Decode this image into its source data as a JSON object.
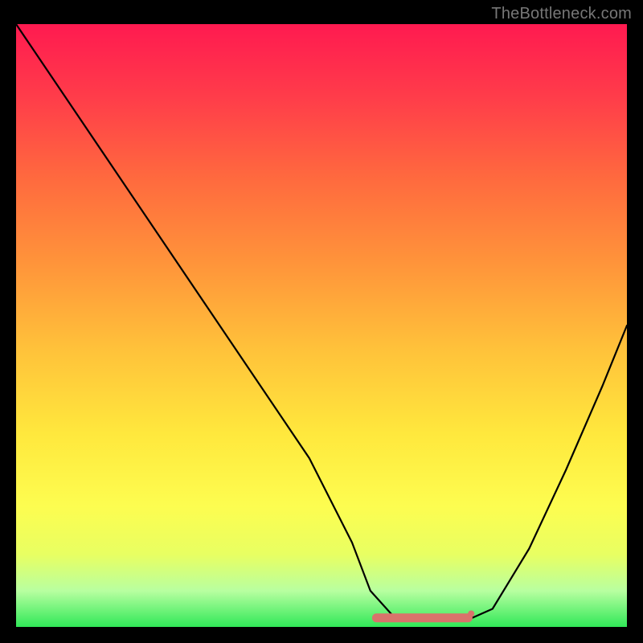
{
  "watermark": "TheBottleneck.com",
  "chart_data": {
    "type": "line",
    "title": "",
    "xlabel": "",
    "ylabel": "",
    "xlim": [
      0,
      100
    ],
    "ylim": [
      0,
      100
    ],
    "series": [
      {
        "name": "bottleneck-curve",
        "x": [
          0,
          8,
          16,
          24,
          32,
          40,
          48,
          55,
          58,
          62,
          66,
          70,
          74,
          78,
          84,
          90,
          96,
          100
        ],
        "values": [
          100,
          88,
          76,
          64,
          52,
          40,
          28,
          14,
          6,
          1.5,
          1.0,
          1.0,
          1.2,
          3,
          13,
          26,
          40,
          50
        ]
      }
    ],
    "annotations": [
      {
        "name": "valley-marker",
        "type": "thick-segment",
        "color": "#d9736b",
        "x": [
          59,
          74
        ],
        "y": [
          1.5,
          1.5
        ]
      },
      {
        "name": "valley-dot-right",
        "type": "dot",
        "color": "#d9736b",
        "x": 74.5,
        "y": 2.2,
        "r": 4
      }
    ],
    "gradient_stops": [
      {
        "pos": 0.0,
        "color": "#ff1a50"
      },
      {
        "pos": 0.12,
        "color": "#ff3c4a"
      },
      {
        "pos": 0.26,
        "color": "#ff6b3e"
      },
      {
        "pos": 0.4,
        "color": "#ff953a"
      },
      {
        "pos": 0.54,
        "color": "#ffc23a"
      },
      {
        "pos": 0.68,
        "color": "#ffe83d"
      },
      {
        "pos": 0.8,
        "color": "#fdfd50"
      },
      {
        "pos": 0.88,
        "color": "#e8ff62"
      },
      {
        "pos": 0.94,
        "color": "#b8ffa0"
      },
      {
        "pos": 1.0,
        "color": "#30e858"
      }
    ]
  }
}
